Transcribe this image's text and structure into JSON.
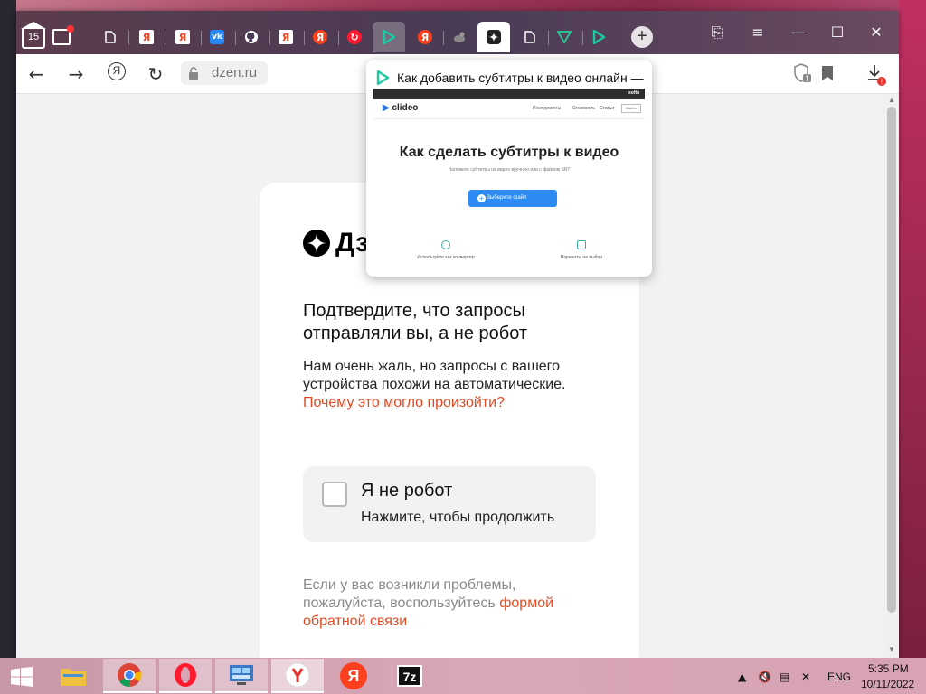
{
  "browser": {
    "tab_counter": "15",
    "address": "dzen.ru",
    "preview": {
      "title": "Как добавить субтитры к видео онлайн — Clideo",
      "thumbnail": {
        "logo": "clideo",
        "nav_links": [
          "Инструменты",
          "Стоимость",
          "Статьи"
        ],
        "login": "Войти",
        "headline": "Как сделать субтитры к видео",
        "subline": "Наложите субтитры на видео вручную или с файлом SRT",
        "button": "Выберите файл",
        "feature_left": "Используйте как конвертер",
        "feature_right": "Варианты на выбор",
        "topbar_brand": "softo"
      }
    },
    "tabs": [
      {
        "icon": "document-icon"
      },
      {
        "icon": "yandex-icon"
      },
      {
        "icon": "yandex-icon"
      },
      {
        "icon": "vk-icon"
      },
      {
        "icon": "github-icon"
      },
      {
        "icon": "yandex-icon"
      },
      {
        "icon": "yandex-icon"
      },
      {
        "icon": "opera-icon"
      },
      {
        "icon": "play-icon",
        "state": "hover"
      },
      {
        "icon": "yandex-icon"
      },
      {
        "icon": "bird-icon"
      },
      {
        "icon": "star-icon",
        "state": "active"
      },
      {
        "icon": "document-icon"
      },
      {
        "icon": "v-icon"
      },
      {
        "icon": "play-icon"
      }
    ],
    "download_badge": "!"
  },
  "page": {
    "brand": "Дзен",
    "title": "Подтвердите, что запросы отправляли вы, а не робот",
    "text_before_link": "Нам очень жаль, но запросы с вашего устройства похожи на автоматические.",
    "why_link": "Почему это могло произойти?",
    "captcha": {
      "label": "Я не робот",
      "sublabel": "Нажмите, чтобы продолжить"
    },
    "footer_text": "Если у вас возникли проблемы, пожалуйста, воспользуйтесь",
    "feedback_link": "формой обратной связи"
  },
  "taskbar": {
    "items": [
      "file-explorer",
      "chrome",
      "opera",
      "control-panel",
      "yandex-browser",
      "yandex",
      "7zip"
    ],
    "language": "ENG",
    "time": "5:35 PM",
    "date": "10/11/2022",
    "icon_7z": "7z",
    "icon_ya": "Я"
  },
  "colors": {
    "accent_link": "#e14b23",
    "tabbar": "#4a3b55"
  }
}
